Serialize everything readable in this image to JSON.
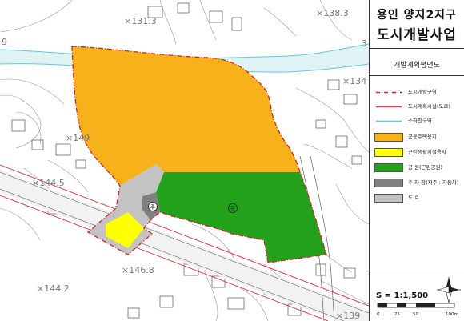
{
  "title": {
    "line1": "용인 양지2지구",
    "line2": "도시개발사업"
  },
  "subtitle": "개발계획평면도",
  "legend": [
    {
      "label": "도시개발구역",
      "kind": "line-dashed-red",
      "color": "#d2232a"
    },
    {
      "label": "도시계획시설(도로)",
      "kind": "line-red",
      "color": "#e0404a"
    },
    {
      "label": "소하천구역",
      "kind": "line-cyan",
      "color": "#5ecbd7"
    },
    {
      "label": "공동주택용지",
      "kind": "fill",
      "color": "#f7b21b"
    },
    {
      "label": "근린생활시설용지",
      "kind": "fill",
      "color": "#ffff00"
    },
    {
      "label": "공 원(근린공원)",
      "kind": "fill",
      "color": "#22a11b"
    },
    {
      "label": "주 차 장(자주 : 자동차)",
      "kind": "fill",
      "color": "#7f7f7f"
    },
    {
      "label": "도 로",
      "kind": "fill",
      "color": "#c3c3c3"
    }
  ],
  "scale": {
    "text": "S = 1:1,500",
    "ticks": [
      "0",
      "25",
      "50",
      "100m"
    ]
  },
  "map_labels": {
    "elev1": "×131.3",
    "elev2": "×138.3",
    "elev3": "×134",
    "elev4": "×149",
    "elev5": "×144.5",
    "elev6": "×146.8",
    "elev7": "×144.2",
    "elev8": "×139",
    "edge_9": "9",
    "edge_3": "3",
    "parking_mark": "주",
    "park_mark": "공"
  },
  "colors": {
    "apartment": "#f7b21b",
    "commercial": "#ffff00",
    "park": "#22a11b",
    "parking": "#7f7f7f",
    "road": "#c3c3c3",
    "boundary": "#d2232a",
    "river": "#5ecbd7"
  }
}
